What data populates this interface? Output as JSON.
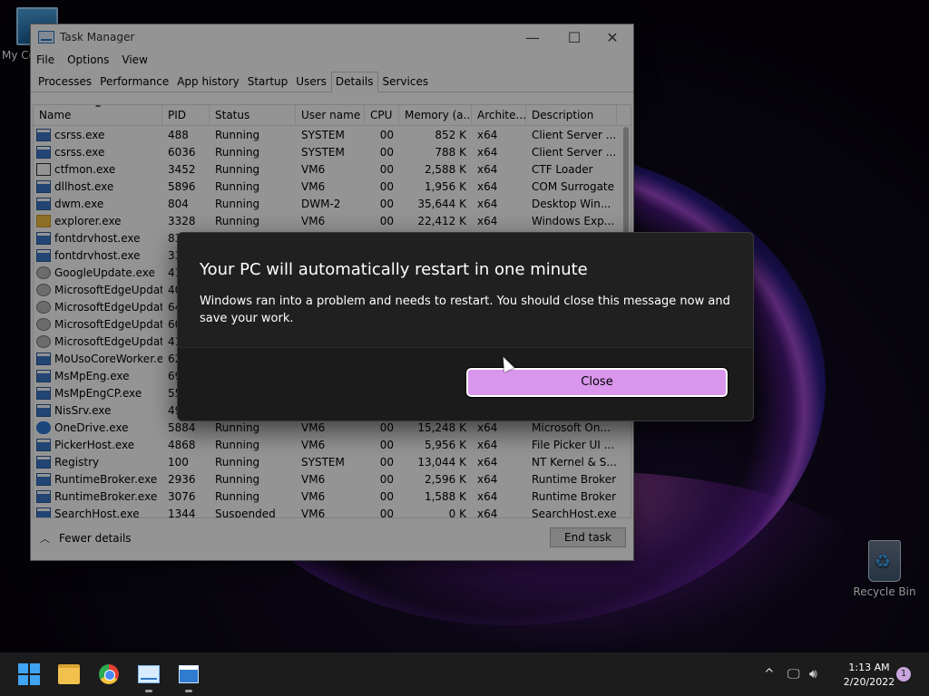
{
  "desktop": {
    "icons": [
      {
        "label": "My Co"
      },
      {
        "label": "Recycle Bin"
      }
    ]
  },
  "task_manager": {
    "title": "Task Manager",
    "window_controls": {
      "minimize": "—",
      "maximize": "☐",
      "close": "✕"
    },
    "menu": [
      "File",
      "Options",
      "View"
    ],
    "tabs": [
      {
        "label": "Processes"
      },
      {
        "label": "Performance"
      },
      {
        "label": "App history"
      },
      {
        "label": "Startup"
      },
      {
        "label": "Users"
      },
      {
        "label": "Details",
        "active": true
      },
      {
        "label": "Services"
      }
    ],
    "columns": [
      "Name",
      "PID",
      "Status",
      "User name",
      "CPU",
      "Memory (a...",
      "Archite...",
      "Description"
    ],
    "rows": [
      {
        "name": "csrss.exe",
        "pid": "488",
        "status": "Running",
        "user": "SYSTEM",
        "cpu": "00",
        "memory": "852 K",
        "arch": "x64",
        "desc": "Client Server ...",
        "icon": "window-icon"
      },
      {
        "name": "csrss.exe",
        "pid": "6036",
        "status": "Running",
        "user": "SYSTEM",
        "cpu": "00",
        "memory": "788 K",
        "arch": "x64",
        "desc": "Client Server ...",
        "icon": "window-icon"
      },
      {
        "name": "ctfmon.exe",
        "pid": "3452",
        "status": "Running",
        "user": "VM6",
        "cpu": "00",
        "memory": "2,588 K",
        "arch": "x64",
        "desc": "CTF Loader",
        "icon": "pen-icon"
      },
      {
        "name": "dllhost.exe",
        "pid": "5896",
        "status": "Running",
        "user": "VM6",
        "cpu": "00",
        "memory": "1,956 K",
        "arch": "x64",
        "desc": "COM Surrogate",
        "icon": "window-icon"
      },
      {
        "name": "dwm.exe",
        "pid": "804",
        "status": "Running",
        "user": "DWM-2",
        "cpu": "00",
        "memory": "35,644 K",
        "arch": "x64",
        "desc": "Desktop Win...",
        "icon": "window-icon"
      },
      {
        "name": "explorer.exe",
        "pid": "3328",
        "status": "Running",
        "user": "VM6",
        "cpu": "00",
        "memory": "22,412 K",
        "arch": "x64",
        "desc": "Windows Exp...",
        "icon": "folder-icon"
      },
      {
        "name": "fontdrvhost.exe",
        "pid": "83",
        "status": "",
        "user": "",
        "cpu": "",
        "memory": "",
        "arch": "",
        "desc": "",
        "icon": "window-icon"
      },
      {
        "name": "fontdrvhost.exe",
        "pid": "33",
        "status": "",
        "user": "",
        "cpu": "",
        "memory": "",
        "arch": "",
        "desc": "",
        "icon": "window-icon"
      },
      {
        "name": "GoogleUpdate.exe",
        "pid": "41",
        "status": "",
        "user": "",
        "cpu": "",
        "memory": "",
        "arch": "",
        "desc": "",
        "icon": "gear-icon"
      },
      {
        "name": "MicrosoftEdgeUpdat...",
        "pid": "40",
        "status": "",
        "user": "",
        "cpu": "",
        "memory": "",
        "arch": "",
        "desc": "",
        "icon": "gear-icon"
      },
      {
        "name": "MicrosoftEdgeUpdat...",
        "pid": "64",
        "status": "",
        "user": "",
        "cpu": "",
        "memory": "",
        "arch": "",
        "desc": "",
        "icon": "gear-icon"
      },
      {
        "name": "MicrosoftEdgeUpdat...",
        "pid": "60",
        "status": "",
        "user": "",
        "cpu": "",
        "memory": "",
        "arch": "",
        "desc": "",
        "icon": "gear-icon"
      },
      {
        "name": "MicrosoftEdgeUpdat...",
        "pid": "41",
        "status": "",
        "user": "",
        "cpu": "",
        "memory": "",
        "arch": "",
        "desc": "",
        "icon": "gear-icon"
      },
      {
        "name": "MoUsoCoreWorker.e...",
        "pid": "62",
        "status": "",
        "user": "",
        "cpu": "",
        "memory": "",
        "arch": "",
        "desc": "",
        "icon": "window-icon"
      },
      {
        "name": "MsMpEng.exe",
        "pid": "69",
        "status": "",
        "user": "",
        "cpu": "",
        "memory": "",
        "arch": "",
        "desc": "",
        "icon": "window-icon"
      },
      {
        "name": "MsMpEngCP.exe",
        "pid": "55",
        "status": "",
        "user": "",
        "cpu": "",
        "memory": "",
        "arch": "",
        "desc": "",
        "icon": "window-icon"
      },
      {
        "name": "NisSrv.exe",
        "pid": "49",
        "status": "",
        "user": "",
        "cpu": "",
        "memory": "",
        "arch": "",
        "desc": "",
        "icon": "window-icon"
      },
      {
        "name": "OneDrive.exe",
        "pid": "5884",
        "status": "Running",
        "user": "VM6",
        "cpu": "00",
        "memory": "15,248 K",
        "arch": "x64",
        "desc": "Microsoft On...",
        "icon": "cloud-icon"
      },
      {
        "name": "PickerHost.exe",
        "pid": "4868",
        "status": "Running",
        "user": "VM6",
        "cpu": "00",
        "memory": "5,956 K",
        "arch": "x64",
        "desc": "File Picker UI ...",
        "icon": "window-icon"
      },
      {
        "name": "Registry",
        "pid": "100",
        "status": "Running",
        "user": "SYSTEM",
        "cpu": "00",
        "memory": "13,044 K",
        "arch": "x64",
        "desc": "NT Kernel & S...",
        "icon": "window-icon"
      },
      {
        "name": "RuntimeBroker.exe",
        "pid": "2936",
        "status": "Running",
        "user": "VM6",
        "cpu": "00",
        "memory": "2,596 K",
        "arch": "x64",
        "desc": "Runtime Broker",
        "icon": "window-icon"
      },
      {
        "name": "RuntimeBroker.exe",
        "pid": "3076",
        "status": "Running",
        "user": "VM6",
        "cpu": "00",
        "memory": "1,588 K",
        "arch": "x64",
        "desc": "Runtime Broker",
        "icon": "window-icon"
      },
      {
        "name": "SearchHost.exe",
        "pid": "1344",
        "status": "Suspended",
        "user": "VM6",
        "cpu": "00",
        "memory": "0 K",
        "arch": "x64",
        "desc": "SearchHost.exe",
        "icon": "window-icon"
      }
    ],
    "footer": {
      "fewer_details": "Fewer details",
      "end_task": "End task"
    }
  },
  "dialog": {
    "title": "Your PC will automatically restart in one minute",
    "message": "Windows ran into a problem and needs to restart. You should close this message now and save your work.",
    "close_label": "Close",
    "accent": "#d996ec"
  },
  "taskbar": {
    "apps": [
      "start-icon",
      "file-explorer-icon",
      "chrome-icon",
      "task-manager-icon",
      "app-window-icon"
    ],
    "tray": {
      "chevron": "^",
      "time": "1:13 AM",
      "date": "2/20/2022",
      "notification_count": "1"
    }
  }
}
